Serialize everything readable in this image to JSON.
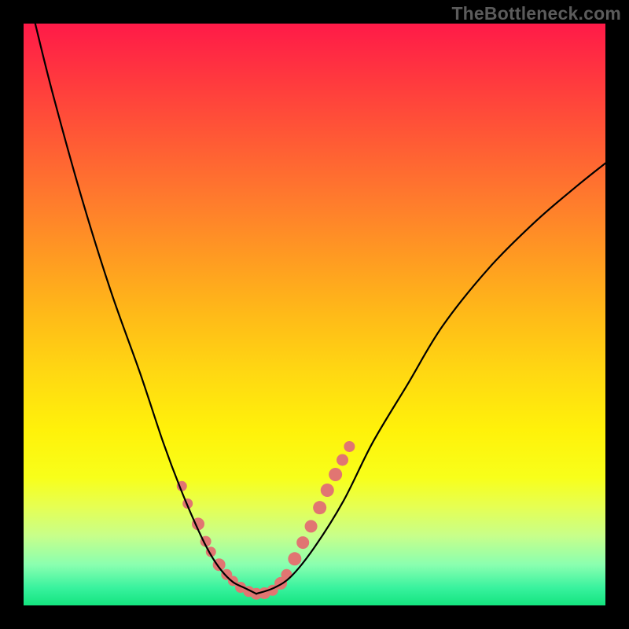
{
  "watermark": "TheBottleneck.com",
  "chart_data": {
    "type": "line",
    "title": "",
    "xlabel": "",
    "ylabel": "",
    "xlim": [
      0,
      1
    ],
    "ylim": [
      0,
      1
    ],
    "series": [
      {
        "name": "left-curve",
        "x": [
          0.02,
          0.05,
          0.1,
          0.15,
          0.2,
          0.24,
          0.27,
          0.3,
          0.32,
          0.34,
          0.36,
          0.38,
          0.4
        ],
        "values": [
          1.0,
          0.88,
          0.7,
          0.54,
          0.4,
          0.28,
          0.2,
          0.13,
          0.09,
          0.06,
          0.04,
          0.03,
          0.02
        ]
      },
      {
        "name": "right-curve",
        "x": [
          0.4,
          0.43,
          0.46,
          0.5,
          0.55,
          0.6,
          0.66,
          0.72,
          0.8,
          0.88,
          0.95,
          1.0
        ],
        "values": [
          0.02,
          0.03,
          0.05,
          0.1,
          0.18,
          0.28,
          0.38,
          0.48,
          0.58,
          0.66,
          0.72,
          0.76
        ]
      }
    ],
    "markers": {
      "name": "guide-dots",
      "color": "#e17572",
      "points": [
        {
          "x": 0.272,
          "y": 0.205,
          "r": 6.5
        },
        {
          "x": 0.282,
          "y": 0.175,
          "r": 6.5
        },
        {
          "x": 0.3,
          "y": 0.14,
          "r": 8.0
        },
        {
          "x": 0.313,
          "y": 0.11,
          "r": 7.0
        },
        {
          "x": 0.322,
          "y": 0.092,
          "r": 6.5
        },
        {
          "x": 0.336,
          "y": 0.07,
          "r": 8.0
        },
        {
          "x": 0.349,
          "y": 0.053,
          "r": 7.0
        },
        {
          "x": 0.36,
          "y": 0.042,
          "r": 6.5
        },
        {
          "x": 0.373,
          "y": 0.031,
          "r": 7.0
        },
        {
          "x": 0.387,
          "y": 0.024,
          "r": 7.0
        },
        {
          "x": 0.4,
          "y": 0.02,
          "r": 7.5
        },
        {
          "x": 0.414,
          "y": 0.021,
          "r": 7.5
        },
        {
          "x": 0.428,
          "y": 0.026,
          "r": 7.0
        },
        {
          "x": 0.442,
          "y": 0.038,
          "r": 8.0
        },
        {
          "x": 0.452,
          "y": 0.053,
          "r": 7.0
        },
        {
          "x": 0.466,
          "y": 0.08,
          "r": 8.5
        },
        {
          "x": 0.48,
          "y": 0.108,
          "r": 8.0
        },
        {
          "x": 0.494,
          "y": 0.136,
          "r": 8.0
        },
        {
          "x": 0.509,
          "y": 0.168,
          "r": 8.5
        },
        {
          "x": 0.522,
          "y": 0.198,
          "r": 8.5
        },
        {
          "x": 0.536,
          "y": 0.225,
          "r": 8.5
        },
        {
          "x": 0.548,
          "y": 0.25,
          "r": 7.5
        },
        {
          "x": 0.56,
          "y": 0.273,
          "r": 7.0
        }
      ]
    },
    "gradient": {
      "orientation": "vertical",
      "stops": [
        {
          "pos": 0.0,
          "color": "#ff1a48"
        },
        {
          "pos": 0.5,
          "color": "#ffba18"
        },
        {
          "pos": 0.78,
          "color": "#f8ff1a"
        },
        {
          "pos": 1.0,
          "color": "#14e47f"
        }
      ]
    }
  }
}
